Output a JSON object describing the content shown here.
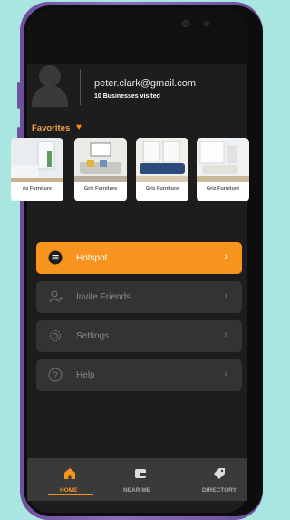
{
  "profile": {
    "email": "peter.clark@gmail.com",
    "visited": "10 Businesses visited"
  },
  "favorites": {
    "label": "Favorites",
    "items": [
      {
        "label": "riz Furniture"
      },
      {
        "label": "Griz Furniture"
      },
      {
        "label": "Griz Furniture"
      },
      {
        "label": "Griz Furniture"
      }
    ]
  },
  "menu": {
    "items": [
      {
        "label": "Hotspot",
        "icon": "list-icon",
        "active": true
      },
      {
        "label": "Invite Friends",
        "icon": "add-user-icon",
        "active": false
      },
      {
        "label": "Settings",
        "icon": "gear-icon",
        "active": false
      },
      {
        "label": "Help",
        "icon": "question-icon",
        "active": false
      }
    ]
  },
  "nav": {
    "tabs": [
      {
        "label": "HOME",
        "icon": "home-icon",
        "active": true
      },
      {
        "label": "NEAR ME",
        "icon": "wallet-icon",
        "active": false
      },
      {
        "label": "DIRECTORY",
        "icon": "tag-icon",
        "active": false
      }
    ]
  },
  "colors": {
    "accent": "#f7941d",
    "background": "#1d1d1d",
    "frame": "#7b5cb0",
    "backdrop": "#a9e6e1"
  }
}
